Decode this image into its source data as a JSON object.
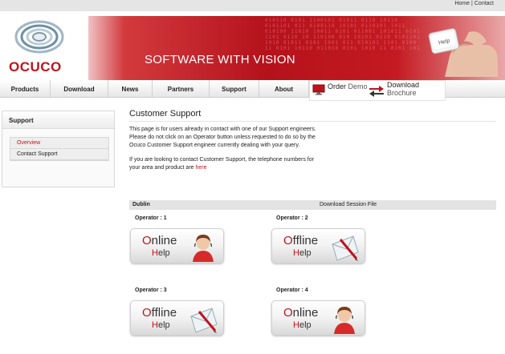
{
  "toplinks": {
    "home": "Home",
    "separator": "|",
    "contact": "Contact"
  },
  "banner": {
    "logo_text": "OCUCO",
    "slogan": "SOFTWARE WITH VISION",
    "key_label": "Help",
    "binary": "010110 0101 1100101 01011 0110 10110 0101101 011 0100110 10101 0110101 1011 010100 11010 10011 0101 011001 101011 0101 1101 0110 10 110100 010 10101 0110 0101101 1010 01011 0101 1001 011 010101 1101 0100 11 0101 10110 011010 0101 1010 11 0101 101"
  },
  "nav": {
    "items": [
      "Products",
      "Download",
      "News",
      "Partners",
      "Support",
      "About"
    ]
  },
  "promo": {
    "order_main": "Order",
    "order_sub": "Demo",
    "download_main": "Download",
    "download_sub": "Brochure"
  },
  "sidebar": {
    "title": "Support",
    "items": [
      {
        "label": "Overview",
        "active": true
      },
      {
        "label": "Contact Support",
        "active": false
      }
    ]
  },
  "main": {
    "title": "Customer Support",
    "intro_lines": [
      "This page is for users already in contact with one of our Support engineers.",
      "Please do not click on an Operator button unless requested to do so by the",
      "Ocuco Customer Support engineer currently dealing with your query."
    ],
    "phone_lines": [
      "If you are looking to contact Customer Support, the telephone numbers for",
      "your area and product are "
    ],
    "phone_link": "here",
    "location": "Dublin",
    "download_session": "Download Session File"
  },
  "operators": [
    {
      "label": "Operator : 1",
      "status_first": "O",
      "status_rest": "nline",
      "help_first": "H",
      "help_rest": "elp",
      "icon": "operator-person-icon"
    },
    {
      "label": "Operator : 2",
      "status_first": "O",
      "status_rest": "ffline",
      "help_first": "H",
      "help_rest": "elp",
      "icon": "envelope-pen-icon"
    },
    {
      "label": "Operator : 3",
      "status_first": "O",
      "status_rest": "ffline",
      "help_first": "H",
      "help_rest": "elp",
      "icon": "envelope-pen-icon"
    },
    {
      "label": "Operator : 4",
      "status_first": "O",
      "status_rest": "nline",
      "help_first": "H",
      "help_rest": "elp",
      "icon": "operator-person-icon"
    }
  ],
  "colors": {
    "brand_red": "#c0121c",
    "banner_red": "#b5121b",
    "nav_bg": "#e6e6e6"
  }
}
